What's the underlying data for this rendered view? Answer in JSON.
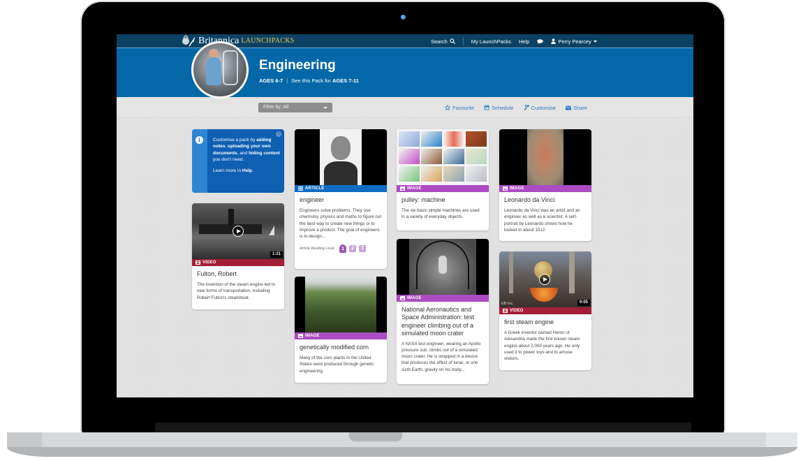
{
  "header": {
    "brand": "Britannica",
    "product": "LaunchPacks",
    "nav": {
      "search": "Search",
      "my_launchpacks": "My LaunchPacks",
      "help": "Help",
      "user": "Perry Pearcey"
    }
  },
  "pack": {
    "title": "Engineering",
    "ages": "AGES 6-7",
    "see_pack_prefix": "See this Pack for",
    "see_pack_ages": "AGES 7-11"
  },
  "toolbar": {
    "filter_label": "Filter by: All",
    "favourite": "Favourite",
    "schedule": "Schedule",
    "customise": "Customise",
    "share": "Share"
  },
  "info_panel": {
    "line1": "Customise a pack by",
    "bold1": "adding notes",
    "sep1": ",",
    "bold2": "uploading your own documents",
    "sep2": ", and",
    "bold3": "hiding content",
    "line2": "you don't need.",
    "learn_prefix": "Learn more in",
    "learn_link": "Help",
    "learn_suffix": "."
  },
  "colors": {
    "topbar": "#0b4263",
    "hero": "#0468a8",
    "article": "#0f6cc2",
    "image": "#ad4bc3",
    "video": "#a31f37",
    "action_link": "#2b78c4"
  },
  "cards": [
    {
      "type": "VIDEO",
      "title": "Fulton, Robert",
      "description": "The invention of the steam engine led to new forms of transportation, including Robert Fulton's steamboat.",
      "duration": "1:21"
    },
    {
      "type": "ARTICLE",
      "title": "engineer",
      "description": "Engineers solve problems. They use chemistry, physics and maths to figure out the best way to create new things or to improve a product. The goal of engineers is to design...",
      "reading_level_label": "Article Reading Level",
      "reading_levels": [
        "1",
        "2",
        "3"
      ],
      "active_level": "1"
    },
    {
      "type": "IMAGE",
      "title": "genetically modified corn",
      "description": "Many of the corn plants in the United States were produced through genetic engineering."
    },
    {
      "type": "IMAGE",
      "title": "pulley: machine",
      "description": "The six basic simple machines are used in a variety of everyday objects."
    },
    {
      "type": "IMAGE",
      "title": "National Aeronautics and Space Administration: test engineer climbing out of a simulated moon crater",
      "description": "A NASA test engineer, wearing an Apollo pressure suit, climbs out of a simulated moon crater. He is strapped in a device that produces the effect of lunar, or one sixth Earth, gravity on his body..."
    },
    {
      "type": "IMAGE",
      "title": "Leonardo da Vinci",
      "description": "Leonardo da Vinci was an artist and an engineer as well as a scientist. A self-portrait by Leonardo shows how he looked in about 1512."
    },
    {
      "type": "VIDEO",
      "title": "first steam engine",
      "description": "A Greek inventor named Heron of Alexandria made the first known steam engine about 2,000 years ago. He only used it to power toys and to amuse visitors.",
      "duration": "0:05",
      "credit": "EB Inc."
    }
  ]
}
